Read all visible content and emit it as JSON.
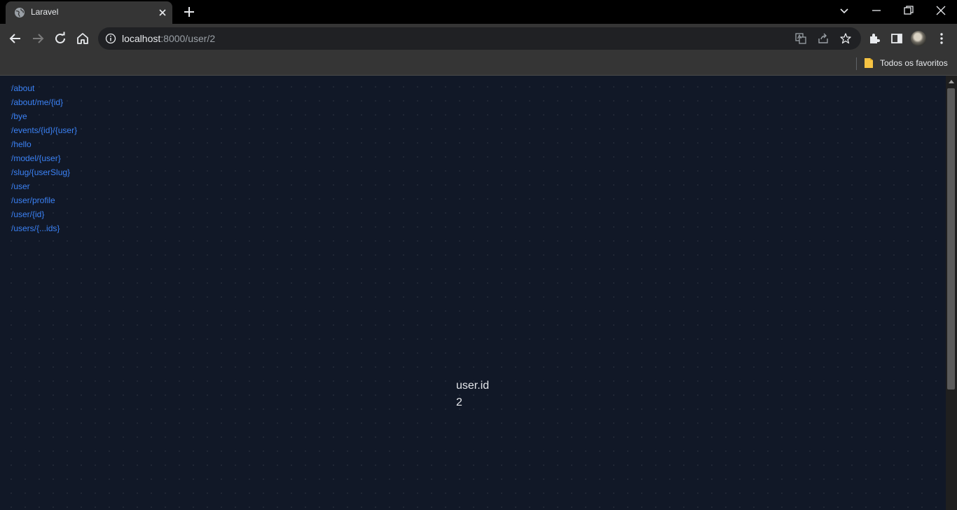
{
  "browser": {
    "tab": {
      "title": "Laravel",
      "favicon_icon": "globe-icon"
    },
    "address_bar": {
      "host": "localhost",
      "path": ":8000/user/2"
    },
    "bookmarks_bar": {
      "folder_label": "Todos os favoritos"
    }
  },
  "page": {
    "routes": [
      {
        "label": "/about"
      },
      {
        "label": "/about/me/{id}"
      },
      {
        "label": "/bye"
      },
      {
        "label": "/events/{id}/{user}"
      },
      {
        "label": "/hello"
      },
      {
        "label": "/model/{user}"
      },
      {
        "label": "/slug/{userSlug}"
      },
      {
        "label": "/user"
      },
      {
        "label": "/user/profile"
      },
      {
        "label": "/user/{id}"
      },
      {
        "label": "/users/{...ids}"
      }
    ],
    "result": {
      "label": "user.id",
      "value": "2"
    }
  },
  "colors": {
    "page_background": "#111827",
    "link": "#3b82f6",
    "result_text": "#e5e7eb",
    "chrome_toolbar": "#353535"
  }
}
